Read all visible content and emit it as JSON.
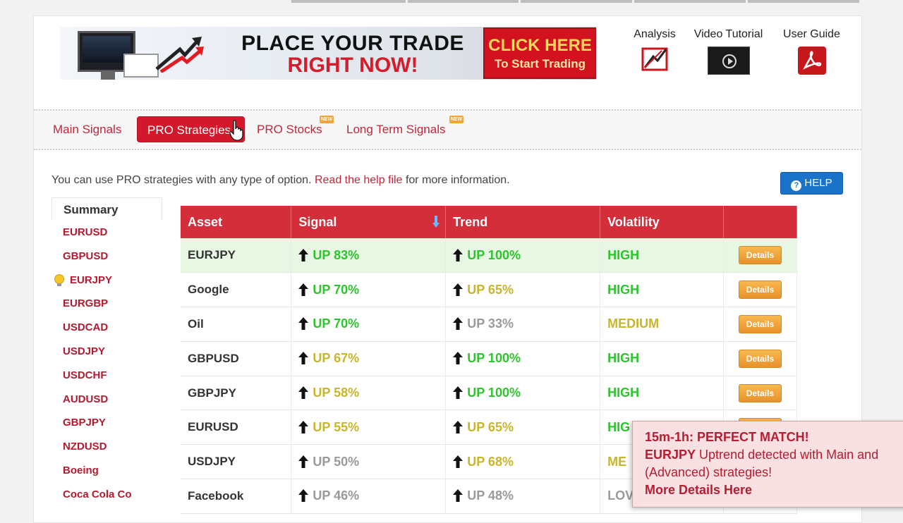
{
  "banner": {
    "headline_line1": "PLACE YOUR TRADE",
    "headline_line2": "RIGHT NOW!",
    "cta_line1": "CLICK HERE",
    "cta_line2": "To Start Trading"
  },
  "tools": [
    {
      "label": "Analysis",
      "icon": "analysis-icon"
    },
    {
      "label": "Video Tutorial",
      "icon": "video-icon"
    },
    {
      "label": "User Guide",
      "icon": "pdf-icon"
    }
  ],
  "tabs": [
    {
      "label": "Main Signals",
      "active": false,
      "new": false
    },
    {
      "label": "PRO Strategies",
      "active": true,
      "new": false
    },
    {
      "label": "PRO Stocks",
      "active": false,
      "new": true
    },
    {
      "label": "Long Term Signals",
      "active": false,
      "new": true
    }
  ],
  "new_badge": "NEW",
  "info": {
    "text_before": "You can use PRO strategies with any type of option.",
    "link": "Read the help file",
    "text_after": "for more information."
  },
  "help_button": "HELP",
  "sidebar": {
    "heading": "Summary",
    "items": [
      "EURUSD",
      "GBPUSD",
      "EURJPY",
      "EURGBP",
      "USDCAD",
      "USDJPY",
      "USDCHF",
      "AUDUSD",
      "GBPJPY",
      "NZDUSD",
      "Boeing",
      "Coca Cola Co"
    ],
    "current": "EURJPY"
  },
  "table": {
    "headers": [
      "Asset",
      "Signal",
      "Trend",
      "Volatility",
      ""
    ],
    "details_label": "Details",
    "rows": [
      {
        "asset": "EURJPY",
        "signal": "UP 83%",
        "signal_color": "green",
        "trend": "UP 100%",
        "trend_color": "green",
        "volatility": "HIGH",
        "vol_color": "green"
      },
      {
        "asset": "Google",
        "signal": "UP 70%",
        "signal_color": "green",
        "trend": "UP 65%",
        "trend_color": "yellow",
        "volatility": "HIGH",
        "vol_color": "green"
      },
      {
        "asset": "Oil",
        "signal": "UP 70%",
        "signal_color": "green",
        "trend": "UP 33%",
        "trend_color": "gray",
        "volatility": "MEDIUM",
        "vol_color": "yellow"
      },
      {
        "asset": "GBPUSD",
        "signal": "UP 67%",
        "signal_color": "yellow",
        "trend": "UP 100%",
        "trend_color": "green",
        "volatility": "HIGH",
        "vol_color": "green"
      },
      {
        "asset": "GBPJPY",
        "signal": "UP 58%",
        "signal_color": "yellow",
        "trend": "UP 100%",
        "trend_color": "green",
        "volatility": "HIGH",
        "vol_color": "green"
      },
      {
        "asset": "EURUSD",
        "signal": "UP 55%",
        "signal_color": "yellow",
        "trend": "UP 65%",
        "trend_color": "yellow",
        "volatility": "HIG",
        "vol_color": "green"
      },
      {
        "asset": "USDJPY",
        "signal": "UP 50%",
        "signal_color": "gray",
        "trend": "UP 68%",
        "trend_color": "yellow",
        "volatility": "ME",
        "vol_color": "yellow"
      },
      {
        "asset": "Facebook",
        "signal": "UP 46%",
        "signal_color": "gray",
        "trend": "UP 48%",
        "trend_color": "gray",
        "volatility": "LOV",
        "vol_color": "gray"
      }
    ]
  },
  "popup": {
    "title": "15m-1h: PERFECT MATCH!",
    "asset": "EURJPY",
    "message_1": "Uptrend detected with Main and",
    "message_2": "(Advanced) strategies!",
    "more": "More Details Here"
  },
  "colors": {
    "brand_red": "#d42e3a",
    "up_green": "#2ec42e",
    "up_yellow": "#c9b52c",
    "neutral_gray": "#9a9a9a",
    "details_orange": "#f0a63a",
    "help_blue": "#1a73c9"
  }
}
